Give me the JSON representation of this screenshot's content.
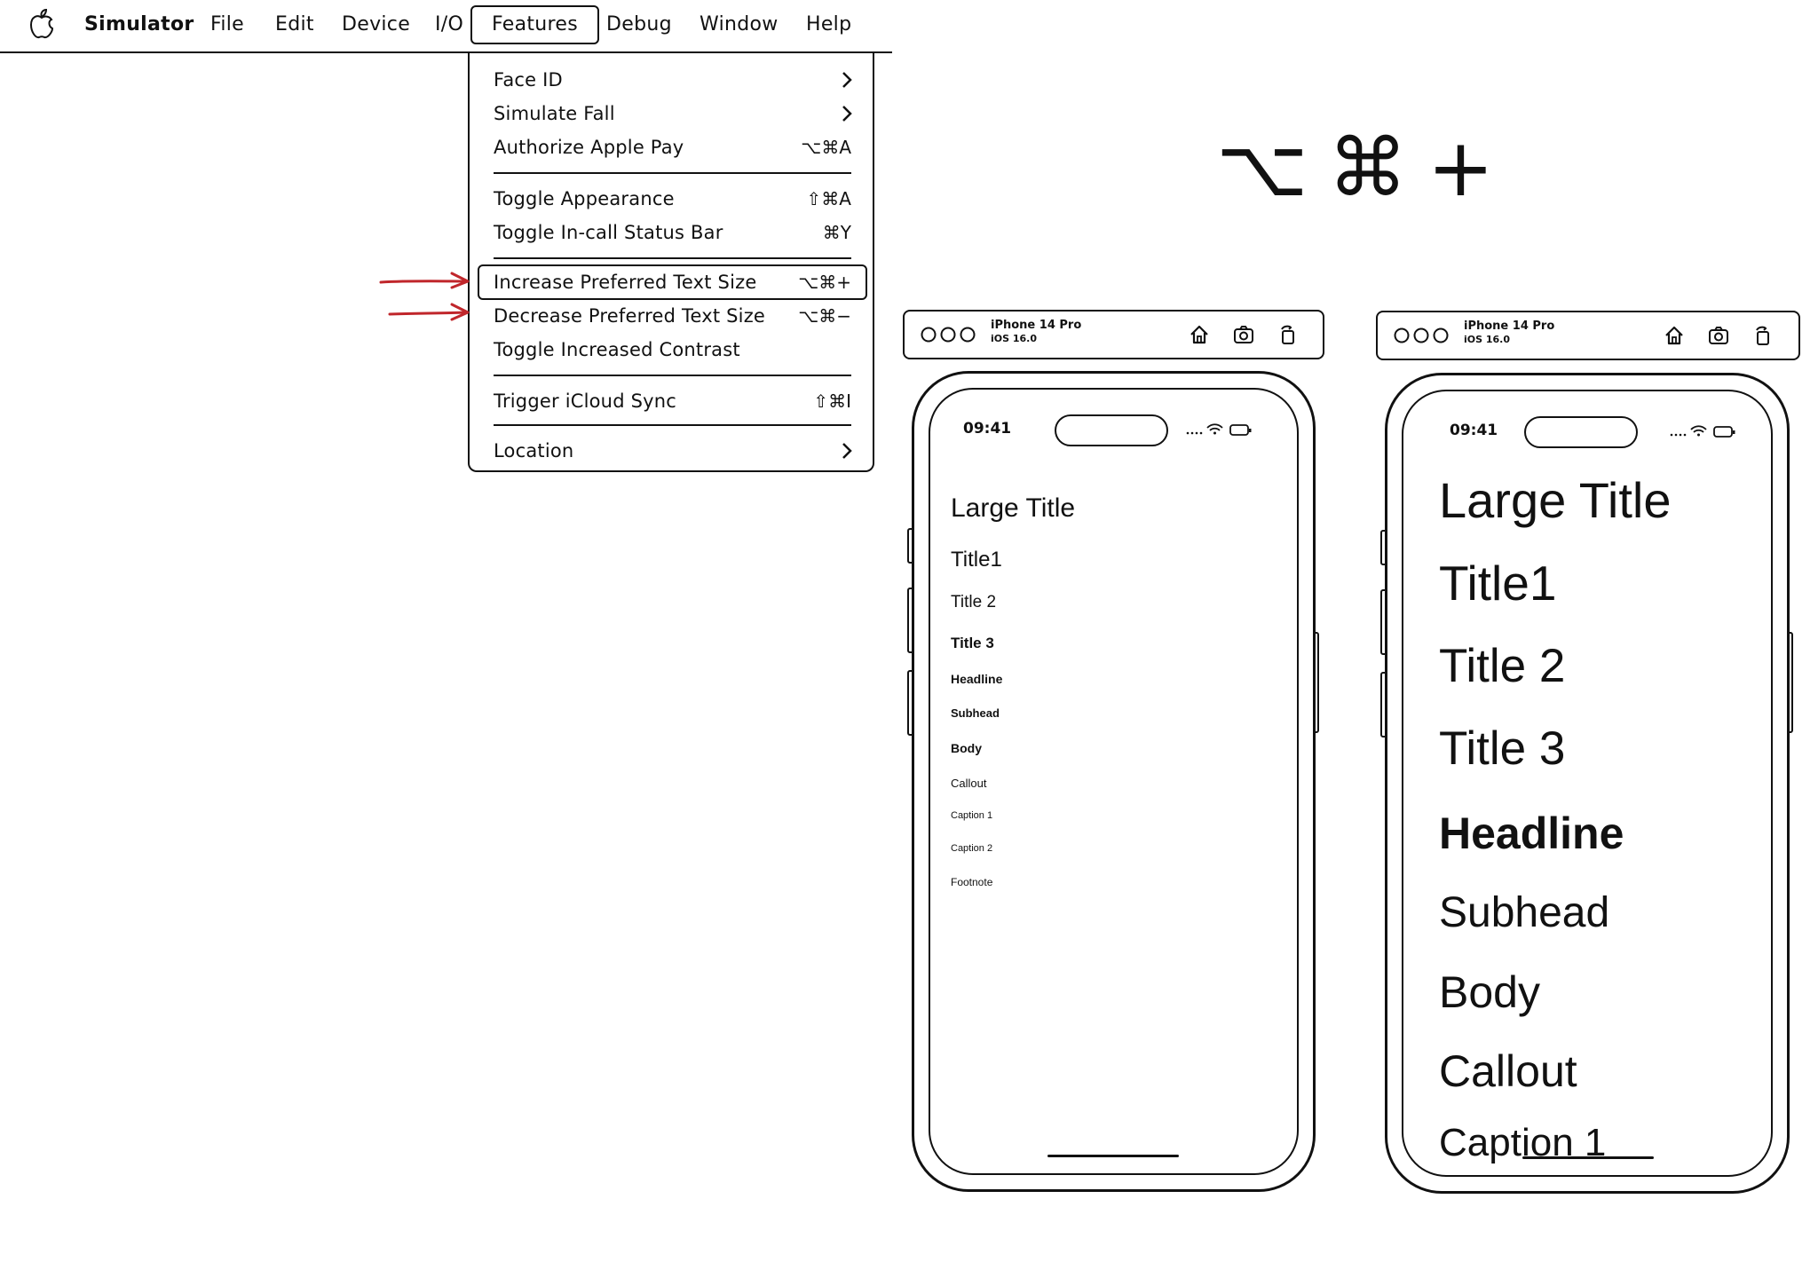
{
  "menubar": {
    "items": [
      "Simulator",
      "File",
      "Edit",
      "Device",
      "I/O",
      "Features",
      "Debug",
      "Window",
      "Help"
    ],
    "active": "Features"
  },
  "features_menu": {
    "items": [
      {
        "label": "Face ID",
        "shortcut": "",
        "submenu": true
      },
      {
        "label": "Simulate Fall",
        "shortcut": "",
        "submenu": true
      },
      {
        "label": "Authorize Apple Pay",
        "shortcut": "⌥⌘A",
        "submenu": false
      },
      {
        "label": "Toggle Appearance",
        "shortcut": "⇧⌘A",
        "submenu": false
      },
      {
        "label": "Toggle In-call Status Bar",
        "shortcut": "⌘Y",
        "submenu": false
      },
      {
        "label": "Increase Preferred Text Size",
        "shortcut": "⌥⌘+",
        "submenu": false
      },
      {
        "label": "Decrease Preferred Text Size",
        "shortcut": "⌥⌘−",
        "submenu": false
      },
      {
        "label": "Toggle Increased Contrast",
        "shortcut": "",
        "submenu": false
      },
      {
        "label": "Trigger iCloud Sync",
        "shortcut": "⇧⌘I",
        "submenu": false
      },
      {
        "label": "Location",
        "shortcut": "",
        "submenu": true
      }
    ],
    "highlighted": "Increase Preferred Text Size"
  },
  "big_shortcut": "⌥⌘+",
  "simulators": [
    {
      "device": "iPhone 14 Pro",
      "os": "iOS 16.0",
      "time": "09:41",
      "text_styles": [
        "Large Title",
        "Title1",
        "Title 2",
        "Title 3",
        "Headline",
        "Subhead",
        "Body",
        "Callout",
        "Caption 1",
        "Caption 2",
        "Footnote"
      ]
    },
    {
      "device": "iPhone 14 Pro",
      "os": "iOS 16.0",
      "time": "09:41",
      "text_styles": [
        "Large Title",
        "Title1",
        "Title 2",
        "Title 3",
        "Headline",
        "Subhead",
        "Body",
        "Callout",
        "Caption 1"
      ]
    }
  ],
  "colors": {
    "ink": "#111111",
    "arrow": "#c0262b"
  }
}
